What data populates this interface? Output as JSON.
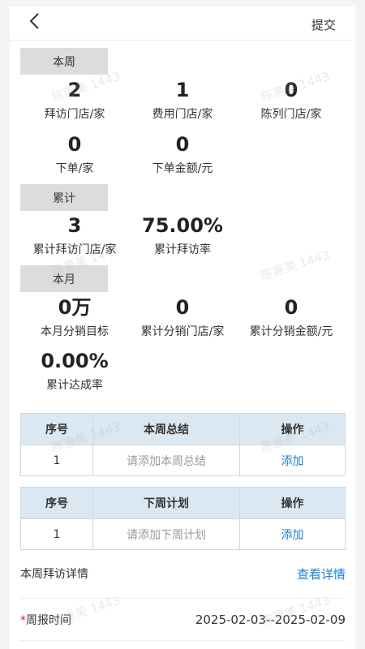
{
  "header": {
    "submit_label": "提交"
  },
  "week": {
    "tag": "本周",
    "stats": [
      {
        "value": "2",
        "label": "拜访门店/家"
      },
      {
        "value": "1",
        "label": "费用门店/家"
      },
      {
        "value": "0",
        "label": "陈列门店/家"
      },
      {
        "value": "0",
        "label": "下单/家"
      },
      {
        "value": "0",
        "label": "下单金额/元"
      }
    ]
  },
  "cumulative": {
    "tag": "累计",
    "stats": [
      {
        "value": "3",
        "label": "累计拜访门店/家"
      },
      {
        "value": "75.00%",
        "label": "累计拜访率"
      }
    ]
  },
  "month": {
    "tag": "本月",
    "stats": [
      {
        "value": "0万",
        "label": "本月分销目标"
      },
      {
        "value": "0",
        "label": "累计分销门店/家"
      },
      {
        "value": "0",
        "label": "累计分销金额/元"
      },
      {
        "value": "0.00%",
        "label": "累计达成率"
      }
    ]
  },
  "summary_table": {
    "headers": [
      "序号",
      "本周总结",
      "操作"
    ],
    "row": {
      "index": "1",
      "placeholder": "请添加本周总结",
      "action": "添加"
    }
  },
  "plan_table": {
    "headers": [
      "序号",
      "下周计划",
      "操作"
    ],
    "row": {
      "index": "1",
      "placeholder": "请添加下周计划",
      "action": "添加"
    }
  },
  "visit_details": {
    "label": "本周拜访详情",
    "link": "查看详情"
  },
  "report_time": {
    "required_mark": "*",
    "label": "周报时间",
    "value": "2025-02-03--2025-02-09"
  },
  "watermark": "陈惠美 1443",
  "colors": {
    "link": "#1a7fd4",
    "table_header": "#dbe8f2",
    "tag_bg": "#dcdcdc",
    "required": "#e02020"
  }
}
